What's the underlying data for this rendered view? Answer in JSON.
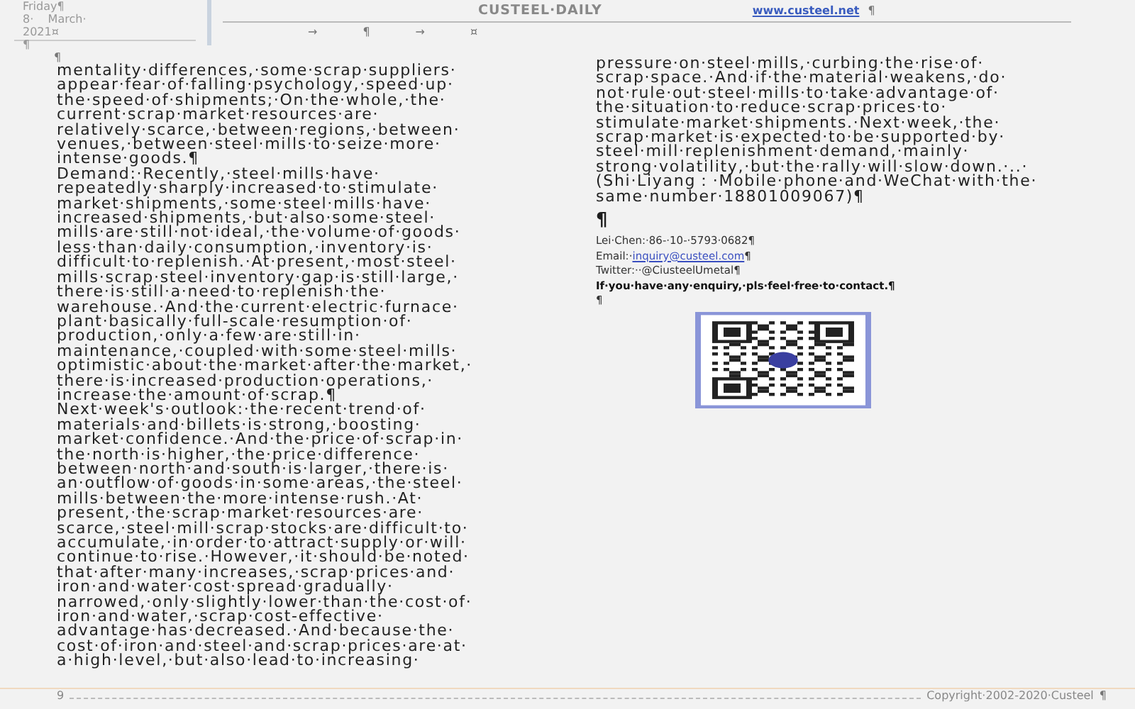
{
  "header": {
    "date_lines": [
      "Friday¶",
      "8·    March·",
      "2021¤"
    ],
    "below_mark": "¶",
    "title": "CUSTEEL·DAILY",
    "website": "www.custeel.net",
    "website_end": "¶",
    "marks": [
      "→",
      "¶",
      "→",
      "¤"
    ]
  },
  "left_column": {
    "top_mark": "¶",
    "lines": [
      "mentality·differences,·some·scrap·suppliers·",
      "appear·fear·of·falling·psychology,·speed·up·",
      "the·speed·of·shipments;·On·the·whole,·the·",
      "current·scrap·market·resources·are·",
      "relatively·scarce,·between·regions,·between·",
      "venues,·between·steel·mills·to·seize·more·",
      "intense·goods.¶",
      "Demand:·Recently,·steel·mills·have·",
      "repeatedly·sharply·increased·to·stimulate·",
      "market·shipments,·some·steel·mills·have·",
      "increased·shipments,·but·also·some·steel·",
      "mills·are·still·not·ideal,·the·volume·of·goods·",
      "less·than·daily·consumption,·inventory·is·",
      "difficult·to·replenish.·At·present,·most·steel·",
      "mills·scrap·steel·inventory·gap·is·still·large,·",
      "there·is·still·a·need·to·replenish·the·",
      "warehouse.·And·the·current·electric·furnace·",
      "plant·basically·full-scale·resumption·of·",
      "production,·only·a·few·are·still·in·",
      "maintenance,·coupled·with·some·steel·mills·",
      "optimistic·about·the·market·after·the·market,·",
      "there·is·increased·production·operations,·",
      "increase·the·amount·of·scrap.¶",
      "Next·week's·outlook:·the·recent·trend·of·",
      "materials·and·billets·is·strong,·boosting·",
      "market·confidence.·And·the·price·of·scrap·in·",
      "the·north·is·higher,·the·price·difference·",
      "between·north·and·south·is·larger,·there·is·",
      "an·outflow·of·goods·in·some·areas,·the·steel·",
      "mills·between·the·more·intense·rush.·At·",
      "present,·the·scrap·market·resources·are·",
      "scarce,·steel·mill·scrap·stocks·are·difficult·to·",
      "accumulate,·in·order·to·attract·supply·or·will·",
      "continue·to·rise.·However,·it·should·be·noted·",
      "that·after·many·increases,·scrap·prices·and·",
      "iron·and·water·cost·spread·gradually·",
      "narrowed,·only·slightly·lower·than·the·cost·of·",
      "iron·and·water,·scrap·cost-effective·",
      "advantage·has·decreased.·And·because·the·",
      "cost·of·iron·and·steel·and·scrap·prices·are·at·",
      "a·high·level,·but·also·lead·to·increasing·"
    ]
  },
  "right_column": {
    "lines": [
      "pressure·on·steel·mills,·curbing·the·rise·of·",
      "scrap·space.·And·if·the·material·weakens,·do·",
      "not·rule·out·steel·mills·to·take·advantage·of·",
      "the·situation·to·reduce·scrap·prices·to·",
      "stimulate·market·shipments.·Next·week,·the·",
      "scrap·market·is·expected·to·be·supported·by·",
      "steel·mill·replenishment·demand,·mainly·",
      "strong·volatility,·but·the·rally·will·slow·down.·..·",
      "(Shi·Liyang：·Mobile·phone·and·WeChat·with·the·",
      "same·number·18801009067)¶"
    ],
    "pilcrow": "¶",
    "contacts": [
      {
        "kind": "text",
        "text": "Lei·Chen:·86-·10-·5793·0682¶"
      },
      {
        "kind": "email",
        "label": "Email:·",
        "link": "inquiry@custeel.com",
        "end": "¶"
      },
      {
        "kind": "text",
        "text": "Twitter:··@CiusteelUmetal¶"
      },
      {
        "kind": "note",
        "text": "If·you·have·any·enquiry,·pls·feel·free·to·contact.¶"
      }
    ],
    "after_mark": "¶"
  },
  "footer": {
    "page": "9",
    "copyright": "Copyright·2002-2020·Custeel",
    "mark": "¶"
  }
}
